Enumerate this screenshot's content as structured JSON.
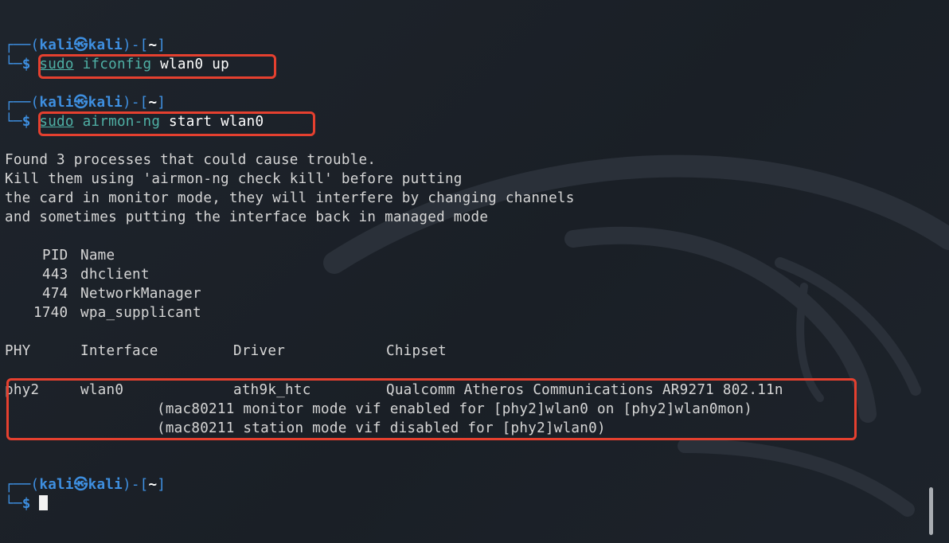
{
  "colors": {
    "background": "#1c2128",
    "prompt_accent": "#3e8fe0",
    "command_accent": "#4fb0a5",
    "highlight_box": "#e5402f"
  },
  "prompts": [
    {
      "open": "┌──(",
      "user": "kali",
      "at": "㉿",
      "host": "kali",
      "mid": ")-[",
      "cwd": "~",
      "close": "]",
      "corner": "└─",
      "symbol": "$",
      "sudo": "sudo",
      "cmd": "ifconfig",
      "args": " wlan0 up"
    },
    {
      "open": "┌──(",
      "user": "kali",
      "at": "㉿",
      "host": "kali",
      "mid": ")-[",
      "cwd": "~",
      "close": "]",
      "corner": "└─",
      "symbol": "$",
      "sudo": "sudo",
      "cmd": "airmon-ng",
      "args": " start wlan0"
    },
    {
      "open": "┌──(",
      "user": "kali",
      "at": "㉿",
      "host": "kali",
      "mid": ")-[",
      "cwd": "~",
      "close": "]",
      "corner": "└─",
      "symbol": "$"
    }
  ],
  "output": {
    "warning": [
      "Found 3 processes that could cause trouble.",
      "Kill them using 'airmon-ng check kill' before putting",
      "the card in monitor mode, they will interfere by changing channels",
      "and sometimes putting the interface back in managed mode"
    ],
    "process_header": {
      "pid": "PID",
      "name": "Name"
    },
    "processes": [
      {
        "pid": "443",
        "name": "dhclient"
      },
      {
        "pid": "474",
        "name": "NetworkManager"
      },
      {
        "pid": "1740",
        "name": "wpa_supplicant"
      }
    ],
    "iface_header": {
      "phy": "PHY",
      "interface": "Interface",
      "driver": "Driver",
      "chipset": "Chipset"
    },
    "iface_row": {
      "phy": "phy2",
      "interface": "wlan0",
      "driver": "ath9k_htc",
      "chipset": "Qualcomm Atheros Communications AR9271 802.11n"
    },
    "notes": [
      "(mac80211 monitor mode vif enabled for [phy2]wlan0 on [phy2]wlan0mon)",
      "(mac80211 station mode vif disabled for [phy2]wlan0)"
    ]
  }
}
